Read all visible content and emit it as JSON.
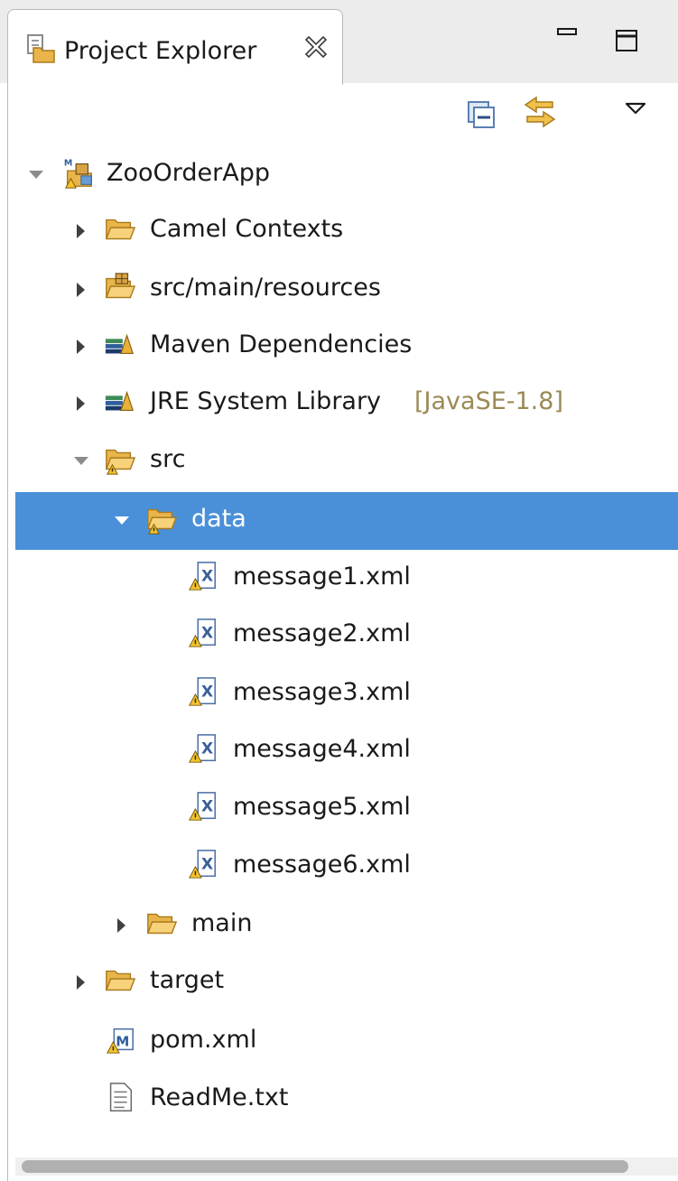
{
  "view": {
    "tab_title": "Project Explorer",
    "tab_icon": "project-explorer-icon",
    "close_icon": "close-icon",
    "minimize_icon": "minimize-icon",
    "maximize_icon": "maximize-icon"
  },
  "toolbar": {
    "collapse_all_icon": "collapse-all-icon",
    "link_with_editor_icon": "link-with-editor-icon",
    "view_menu_icon": "view-menu-icon"
  },
  "tree": {
    "items": [
      {
        "label": "ZooOrderApp",
        "icon": "maven-project-icon",
        "expanded": true
      },
      {
        "label": "Camel Contexts",
        "icon": "folder-icon",
        "expanded": false
      },
      {
        "label": "src/main/resources",
        "icon": "source-folder-icon",
        "expanded": false
      },
      {
        "label": "Maven Dependencies",
        "icon": "library-icon",
        "expanded": false
      },
      {
        "label": "JRE System Library",
        "decoration": "[JavaSE-1.8]",
        "icon": "library-icon",
        "expanded": false
      },
      {
        "label": "src",
        "icon": "folder-warning-icon",
        "expanded": true
      },
      {
        "label": "data",
        "icon": "folder-warning-icon",
        "expanded": true,
        "selected": true
      },
      {
        "label": "message1.xml",
        "icon": "xml-file-warning-icon"
      },
      {
        "label": "message2.xml",
        "icon": "xml-file-warning-icon"
      },
      {
        "label": "message3.xml",
        "icon": "xml-file-warning-icon"
      },
      {
        "label": "message4.xml",
        "icon": "xml-file-warning-icon"
      },
      {
        "label": "message5.xml",
        "icon": "xml-file-warning-icon"
      },
      {
        "label": "message6.xml",
        "icon": "xml-file-warning-icon"
      },
      {
        "label": "main",
        "icon": "folder-icon",
        "expanded": false
      },
      {
        "label": "target",
        "icon": "folder-icon",
        "expanded": false
      },
      {
        "label": "pom.xml",
        "icon": "maven-pom-warning-icon"
      },
      {
        "label": "ReadMe.txt",
        "icon": "text-file-icon"
      }
    ]
  },
  "colors": {
    "selection": "#4a90d9",
    "decoration_text": "#9b8a55",
    "folder": "#f5c36b"
  }
}
